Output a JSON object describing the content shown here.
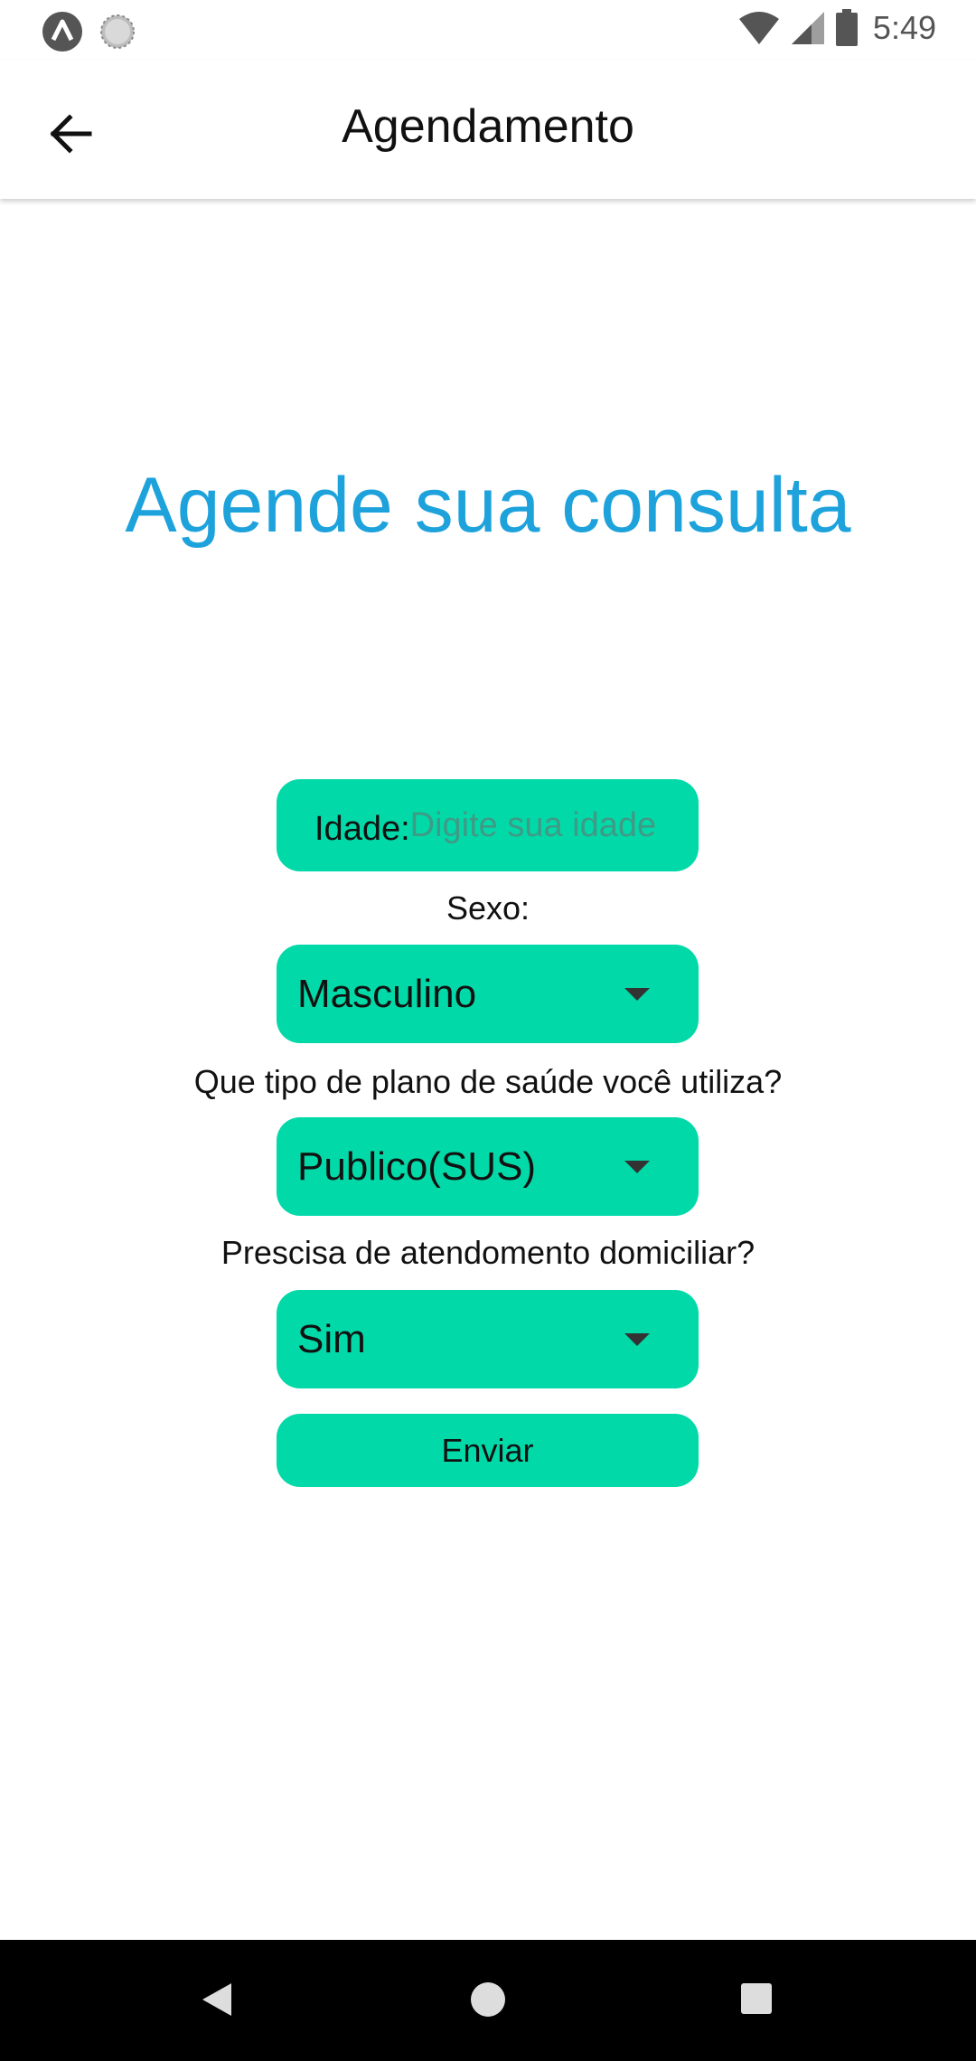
{
  "status_bar": {
    "time": "5:49",
    "icons": [
      "app-notification-icon",
      "sync-icon",
      "wifi-icon",
      "cellular-signal-icon",
      "battery-icon"
    ]
  },
  "app_bar": {
    "title": "Agendamento",
    "back_icon": "arrow-back-icon"
  },
  "form": {
    "headline": "Agende sua consulta",
    "age_label": "Idade:",
    "age_placeholder": "Digite sua idade",
    "age_value": "",
    "sex_label": "Sexo:",
    "sex_selected": "Masculino",
    "plan_label": "Que tipo de plano de saúde você utiliza?",
    "plan_selected": "Publico(SUS)",
    "home_care_label": "Prescisa de atendomento domiciliar?",
    "home_care_selected": "Sim",
    "submit_label": "Enviar"
  },
  "colors": {
    "accent": "#02d9a8",
    "headline": "#1ea2dc",
    "placeholder": "#3f9a86"
  },
  "nav_bar": {
    "icons": [
      "nav-back-icon",
      "nav-home-icon",
      "nav-recents-icon"
    ]
  }
}
